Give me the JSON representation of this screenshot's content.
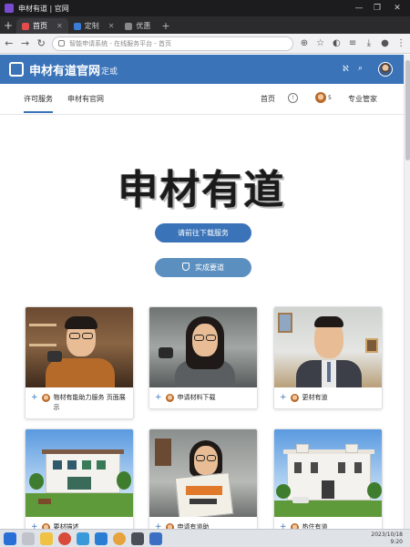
{
  "window": {
    "title": "申材有道 | 官网"
  },
  "tabs": [
    {
      "label": "首页",
      "color": "#e24c4c"
    },
    {
      "label": "定制",
      "color": "#3a7bd5"
    },
    {
      "label": "优惠",
      "color": "#888888"
    }
  ],
  "address": {
    "url": "智能申请系统 - 在线服务平台 - 首页"
  },
  "site": {
    "title": "申材有道官网",
    "title_suffix": "定或",
    "accent": "#3a73b8"
  },
  "subnav": {
    "items": [
      "许可服务",
      "申材有官网"
    ],
    "right_links": [
      "首页",
      "专业管家"
    ],
    "badge_count": "5"
  },
  "hero": {
    "title": "申材有道",
    "primary_button": "请前往下载服务",
    "secondary_button": "实成要道"
  },
  "cards": [
    {
      "caption": "物材有能助力服务 页面展示",
      "image": "young man with glasses"
    },
    {
      "caption": "申请材料下载",
      "image": "woman with glasses"
    },
    {
      "caption": "更材有道",
      "image": "man in suit"
    },
    {
      "caption": "要材描述",
      "image": "white villa"
    },
    {
      "caption": "申请有道助",
      "image": "woman reading"
    },
    {
      "caption": "热住有道",
      "image": "white townhouse"
    }
  ],
  "taskbar": {
    "time": "2023/10/18",
    "date": "9:20"
  }
}
